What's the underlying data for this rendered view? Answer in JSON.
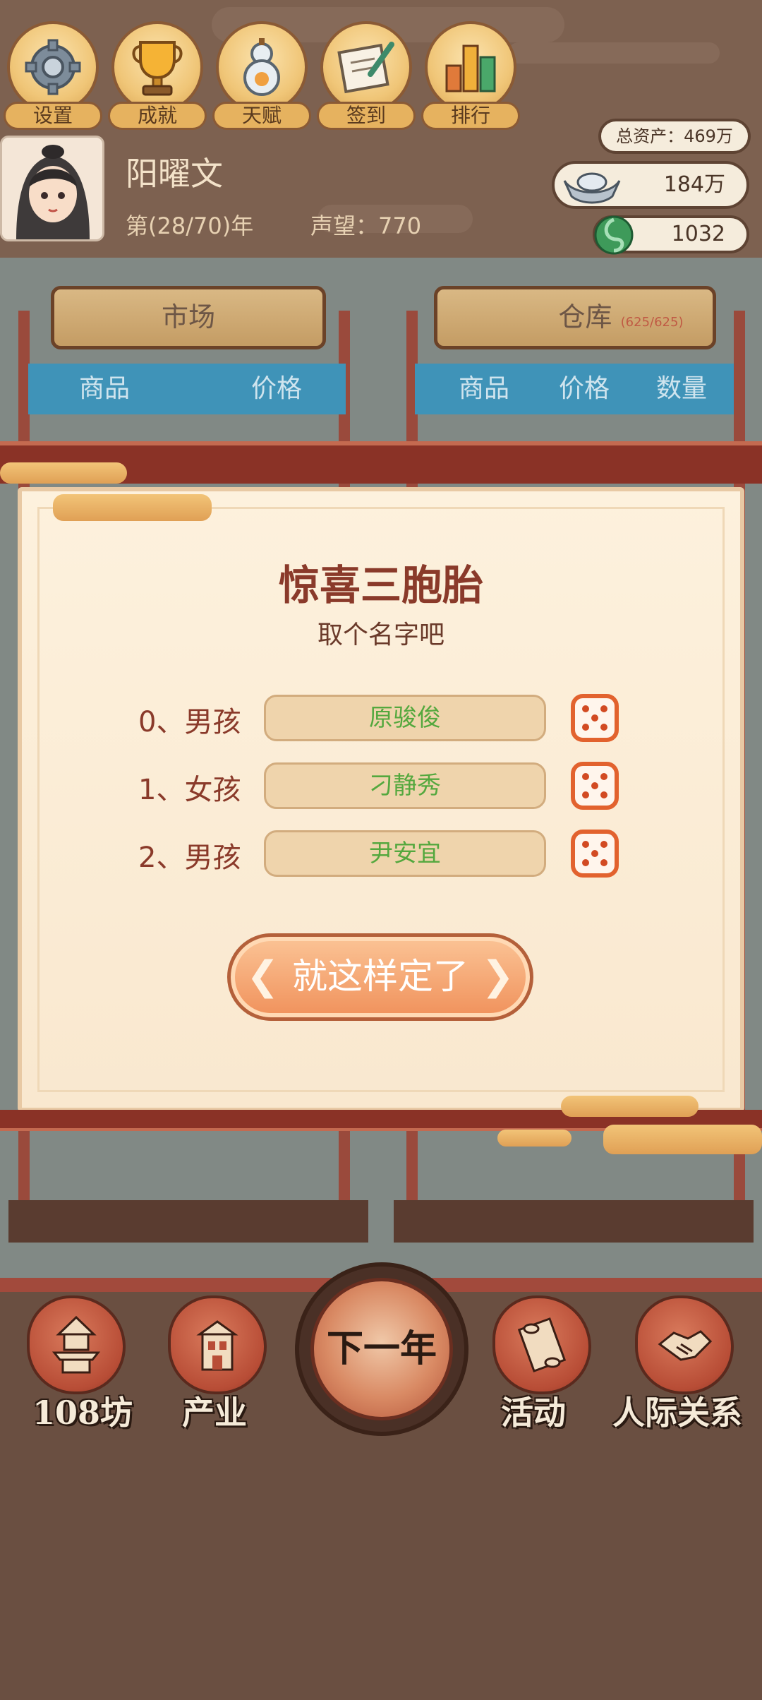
{
  "top_menu": [
    {
      "label": "设置",
      "icon": "gear-icon"
    },
    {
      "label": "成就",
      "icon": "trophy-icon"
    },
    {
      "label": "天赋",
      "icon": "gourd-icon"
    },
    {
      "label": "签到",
      "icon": "scroll-brush-icon"
    },
    {
      "label": "排行",
      "icon": "bar-chart-icon"
    }
  ],
  "player": {
    "name": "阳曜文",
    "year": "第(28/70)年",
    "fame": "声望：770"
  },
  "resources": {
    "total_assets": "总资产：469万",
    "silver": "184万",
    "jade": "1032"
  },
  "market": {
    "title": "市场",
    "col_goods": "商品",
    "col_price": "价格"
  },
  "warehouse": {
    "title": "仓库",
    "capacity": "(625/625)",
    "col_goods": "商品",
    "col_price": "价格",
    "col_qty": "数量"
  },
  "dialog": {
    "title": "惊喜三胞胎",
    "subtitle": "取个名字吧",
    "children": [
      {
        "label": "0、男孩",
        "name": "原骏俊"
      },
      {
        "label": "1、女孩",
        "name": "刁静秀"
      },
      {
        "label": "2、男孩",
        "name": "尹安宜"
      }
    ],
    "confirm": "就这样定了"
  },
  "bottom_nav": {
    "next_year": "下一年",
    "items": [
      {
        "label": "108坊",
        "icon": "pagoda-icon"
      },
      {
        "label": "产业",
        "icon": "building-icon"
      },
      {
        "label": "活动",
        "icon": "scroll-icon"
      },
      {
        "label": "人际关系",
        "icon": "handshake-icon"
      }
    ]
  },
  "colors": {
    "accent": "#f0915b",
    "name_text": "#54a83e",
    "frame": "#8a3226",
    "panel": "#fdf1dd"
  }
}
